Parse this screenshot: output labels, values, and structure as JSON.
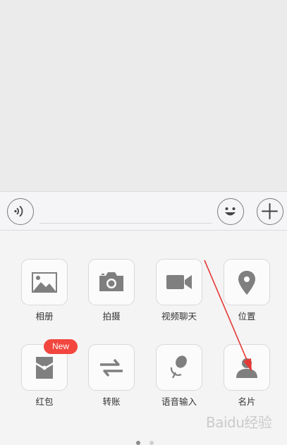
{
  "panel": {
    "items": [
      {
        "label": "相册",
        "icon": "album-icon"
      },
      {
        "label": "拍摄",
        "icon": "camera-icon"
      },
      {
        "label": "视频聊天",
        "icon": "video-camera-icon"
      },
      {
        "label": "位置",
        "icon": "location-pin-icon"
      },
      {
        "label": "红包",
        "icon": "red-envelope-icon",
        "badge": "New"
      },
      {
        "label": "转账",
        "icon": "transfer-arrows-icon"
      },
      {
        "label": "语音输入",
        "icon": "microphone-icon"
      },
      {
        "label": "名片",
        "icon": "contact-card-icon"
      }
    ],
    "page_indicator": {
      "current": 1,
      "total": 2
    }
  },
  "watermark": {
    "text": "Baidu经验"
  },
  "colors": {
    "icon_gray": "#7f7f7f",
    "badge_red": "#f2463e",
    "annotation_red": "#e53935"
  }
}
